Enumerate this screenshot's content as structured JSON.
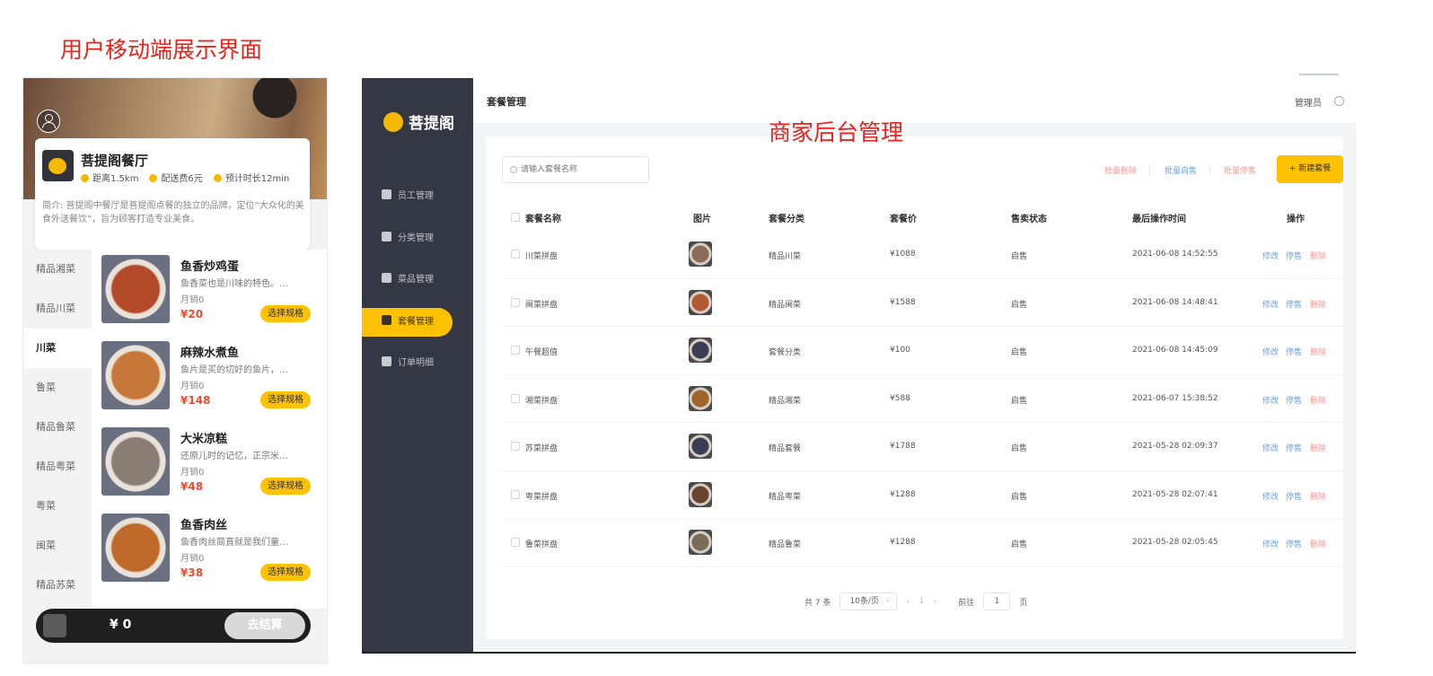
{
  "captions": {
    "left": "用户移动端展示界面",
    "right": "商家后台管理"
  },
  "mobile": {
    "shop": {
      "name": "菩提阁餐厅",
      "distance": "距离1.5km",
      "delivery_fee": "配送费6元",
      "eta": "预计时长12min",
      "description": "简介: 菩提阁中餐厅是菩提阁点餐的独立的品牌，定位“大众化的美食外送餐饮”，旨为顾客打造专业美食。"
    },
    "categories": [
      "精品湘菜",
      "精品川菜",
      "川菜",
      "鲁菜",
      "精品鲁菜",
      "精品粤菜",
      "粤菜",
      "闽菜",
      "精品苏菜"
    ],
    "active_category": "川菜",
    "dishes": [
      {
        "name": "鱼香炒鸡蛋",
        "desc": "鱼香菜也是川味的特色。…",
        "sales": "月销0",
        "price": "¥20",
        "button": "选择规格",
        "color": "#b34a2a"
      },
      {
        "name": "麻辣水煮鱼",
        "desc": "鱼片是买的切好的鱼片，…",
        "sales": "月销0",
        "price": "¥148",
        "button": "选择规格",
        "color": "#c77838"
      },
      {
        "name": "大米凉糕",
        "desc": "还原儿时的记忆，正宗米…",
        "sales": "月销0",
        "price": "¥48",
        "button": "选择规格",
        "color": "#8a7e74"
      },
      {
        "name": "鱼香肉丝",
        "desc": "鱼香肉丝简直就是我们童…",
        "sales": "月销0",
        "price": "¥38",
        "button": "选择规格",
        "color": "#c06a2a"
      }
    ],
    "cart": {
      "total": "¥ 0",
      "checkout": "去结算"
    }
  },
  "admin": {
    "brand": "菩提阁",
    "menu": [
      {
        "label": "员工管理",
        "icon": "info-icon"
      },
      {
        "label": "分类管理",
        "icon": "grid-icon"
      },
      {
        "label": "菜品管理",
        "icon": "dish-icon"
      },
      {
        "label": "套餐管理",
        "icon": "gift-icon"
      },
      {
        "label": "订单明细",
        "icon": "clipboard-icon"
      }
    ],
    "active_menu": "套餐管理",
    "page_title": "套餐管理",
    "user": "管理员",
    "search_placeholder": "请输入套餐名称",
    "bulk_delete": "批量删除",
    "bulk_enable": "批量启售",
    "bulk_disable": "批量停售",
    "new_button": "+ 新建套餐",
    "columns": [
      "套餐名称",
      "图片",
      "套餐分类",
      "套餐价",
      "售卖状态",
      "最后操作时间",
      "操作"
    ],
    "rows": [
      {
        "name": "川菜拼盘",
        "category": "精品川菜",
        "price": "¥1088",
        "status": "启售",
        "time": "2021-06-08 14:52:55",
        "color": "#8b6a5a"
      },
      {
        "name": "闽菜拼盘",
        "category": "精品闽菜",
        "price": "¥1588",
        "status": "启售",
        "time": "2021-06-08 14:48:41",
        "color": "#b35a32"
      },
      {
        "name": "午餐超值",
        "category": "套餐分类",
        "price": "¥100",
        "status": "启售",
        "time": "2021-06-08 14:45:09",
        "color": "#3a3d55"
      },
      {
        "name": "湘菜拼盘",
        "category": "精品湘菜",
        "price": "¥588",
        "status": "启售",
        "time": "2021-06-07 15:38:52",
        "color": "#a0642a"
      },
      {
        "name": "苏菜拼盘",
        "category": "精品套餐",
        "price": "¥1788",
        "status": "启售",
        "time": "2021-05-28 02:09:37",
        "color": "#3a3d55"
      },
      {
        "name": "粤菜拼盘",
        "category": "精品粤菜",
        "price": "¥1288",
        "status": "启售",
        "time": "2021-05-28 02:07:41",
        "color": "#6a4230"
      },
      {
        "name": "鲁菜拼盘",
        "category": "精品鲁菜",
        "price": "¥1288",
        "status": "启售",
        "time": "2021-05-28 02:05:45",
        "color": "#7a6a5a"
      }
    ],
    "row_actions": {
      "edit": "修改",
      "stop": "停售",
      "delete": "删除"
    },
    "pagination": {
      "total": "共 7 条",
      "page_size": "10条/页",
      "current": "1",
      "goto_label": "前往",
      "goto_value": "1",
      "page_suffix": "页"
    }
  }
}
